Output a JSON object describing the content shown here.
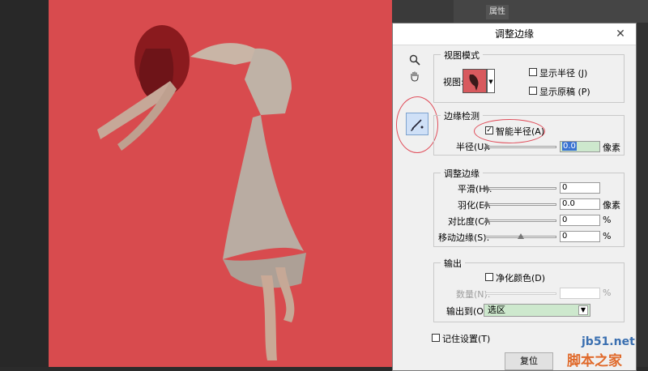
{
  "ps": {
    "panel_tab": "属性"
  },
  "dialog": {
    "title": "调整边缘",
    "close": "✕",
    "view_mode": {
      "legend": "视图模式",
      "view_label": "视图:",
      "show_radius": "显示半径 (J)",
      "show_original": "显示原稿 (P)"
    },
    "edge_detection": {
      "legend": "边缘检测",
      "smart_radius": "智能半径(A)",
      "radius_label": "半径(U):",
      "radius_value": "0.0",
      "radius_unit": "像素"
    },
    "adjust_edge": {
      "legend": "调整边缘",
      "smooth_label": "平滑(H):",
      "smooth_value": "0",
      "feather_label": "羽化(E):",
      "feather_value": "0.0",
      "feather_unit": "像素",
      "contrast_label": "对比度(C):",
      "contrast_value": "0",
      "contrast_unit": "%",
      "shift_label": "移动边缘(S):",
      "shift_value": "0",
      "shift_unit": "%"
    },
    "output": {
      "legend": "输出",
      "decontaminate": "净化颜色(D)",
      "amount_label": "数量(N):",
      "amount_unit": "%",
      "output_to_label": "输出到(O):",
      "output_to_value": "选区"
    },
    "remember": "记住设置(T)",
    "reset_button": "复位"
  },
  "watermark": {
    "site": "jb51.net",
    "brand": "脚本之家"
  }
}
